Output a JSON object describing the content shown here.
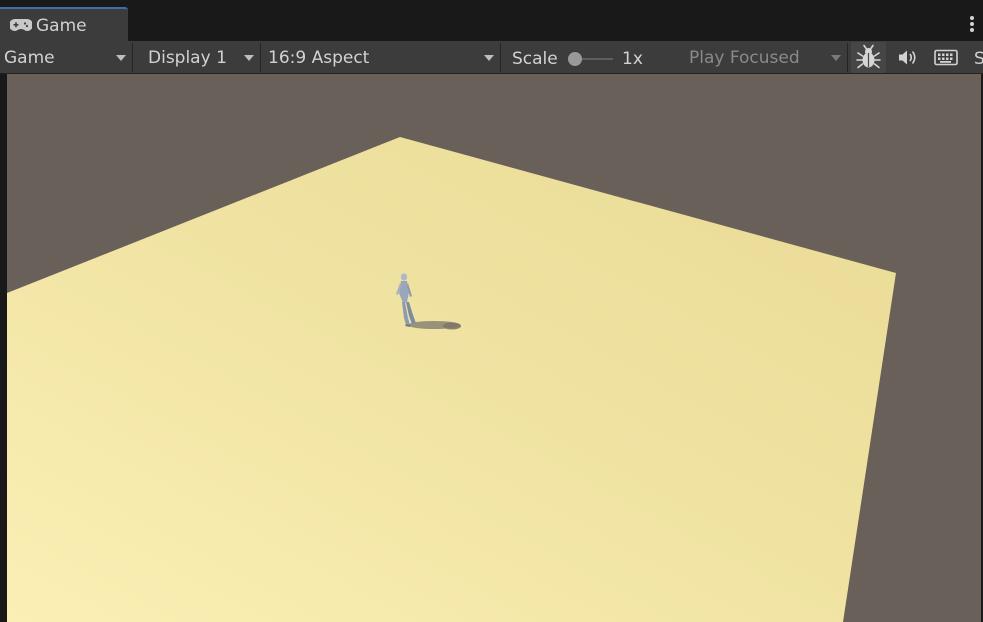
{
  "tab": {
    "label": "Game",
    "icon": "gamepad-icon"
  },
  "toolbar": {
    "view_mode": "Game",
    "display": "Display 1",
    "aspect": "16:9 Aspect",
    "scale_label": "Scale",
    "scale_value": "1x",
    "play_mode": "Play Focused",
    "truncated_label": "S",
    "icons": [
      "bug-icon",
      "audio-icon",
      "keyboard-icon"
    ]
  },
  "colors": {
    "background": "#686059",
    "ground": "#efe2a0",
    "ground_highlight": "#fbefb4",
    "toolbar": "#3c3c3c",
    "tab_accent": "#3d6ea7"
  }
}
